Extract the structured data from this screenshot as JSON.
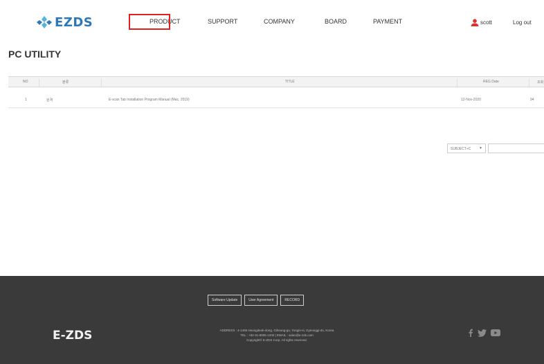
{
  "header": {
    "logo_text": "EZDS",
    "nav": [
      {
        "label": "PRODUCT"
      },
      {
        "label": "SUPPORT"
      },
      {
        "label": "COMPANY"
      },
      {
        "label": "BOARD"
      },
      {
        "label": "PAYMENT"
      }
    ],
    "user_name": "scott",
    "logout_label": "Log out"
  },
  "page": {
    "title": "PC UTILITY"
  },
  "table": {
    "columns": [
      "NO",
      "분류",
      "TITLE",
      "REG Date",
      "조회"
    ],
    "rows": [
      {
        "no": "1",
        "category": "원격",
        "title": "E-scan Tab Installation Program Manual (Mac, 2019)",
        "date": "12-Nov-2020",
        "views": "94"
      }
    ]
  },
  "search": {
    "select_value": "SUBJECT+C",
    "input_value": ""
  },
  "footer": {
    "links": [
      "Software Update",
      "User Agreement",
      "RECORD"
    ],
    "brand": "E-ZDS",
    "info_lines": [
      "ADDRESS : 4-1495 Heungdeok-dong, Giheung-gu, Yongin-si, Gyeonggi-do, Korea",
      "TEL : +82-31-8005-1200   |   EMAIL : sales@e-zds.com",
      "Copyright© E-ZDS Corp. All rights reserved."
    ],
    "social": [
      "facebook-icon",
      "twitter-icon",
      "youtube-icon"
    ]
  },
  "colors": {
    "brand_blue": "#2e78b8",
    "highlight_red": "#e02020",
    "footer_bg": "#3a3a3a"
  }
}
